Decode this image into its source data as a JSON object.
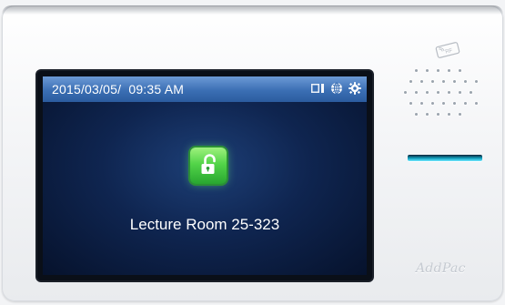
{
  "status_bar": {
    "datetime": "2015/03/05/  09:35 AM",
    "icons": [
      "door-panel-icon",
      "globe-icon",
      "gear-icon"
    ]
  },
  "main": {
    "lock_icon": "unlock-padlock-icon",
    "room_name": "Lecture Room 25-323"
  },
  "device": {
    "brand": "AddPac",
    "rf_badge": "RF"
  },
  "colors": {
    "status_bar": "#3b6fb4",
    "lock_green": "#53d449",
    "screen_bg": "#0f2550",
    "card_slot": "#11a0bf"
  }
}
